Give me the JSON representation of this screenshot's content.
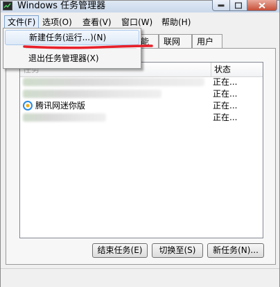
{
  "window": {
    "title": "Windows 任务管理器"
  },
  "menubar": {
    "items": [
      {
        "label": "文件(F)"
      },
      {
        "label": "选项(O)"
      },
      {
        "label": "查看(V)"
      },
      {
        "label": "窗口(W)"
      },
      {
        "label": "帮助(H)"
      }
    ]
  },
  "file_menu": {
    "items": [
      {
        "label": "新建任务(运行...)(N)"
      },
      {
        "label": "退出任务管理器(X)"
      }
    ]
  },
  "tabs": [
    {
      "label": "能"
    },
    {
      "label": "联网"
    },
    {
      "label": "用户"
    }
  ],
  "list": {
    "columns": [
      {
        "label": "任务"
      },
      {
        "label": "状态"
      }
    ],
    "rows": [
      {
        "name": "",
        "status": "正在..."
      },
      {
        "name": "",
        "status": "正在..."
      },
      {
        "name": "腾讯网迷你版",
        "status": "正在..."
      },
      {
        "name": "",
        "status": "正在..."
      }
    ]
  },
  "buttons": {
    "end_task": "结束任务(E)",
    "switch_to": "切换至(S)",
    "new_task": "新任务(N)..."
  },
  "colors": {
    "annotation": "#e8202a",
    "highlight": "#dde9f7"
  }
}
